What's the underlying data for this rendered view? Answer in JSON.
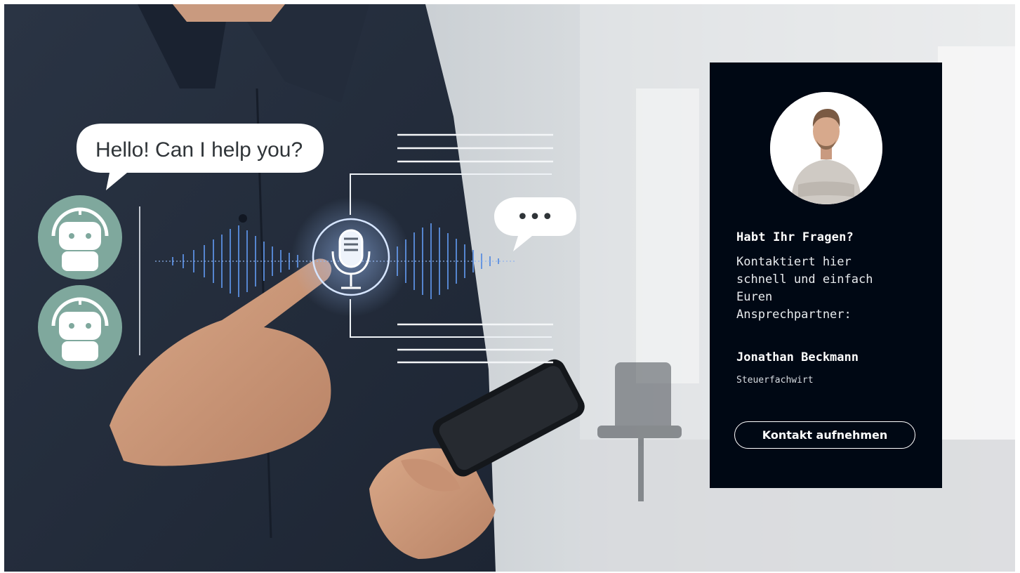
{
  "hero": {
    "chat_bubble_text": "Hello! Can I help you?",
    "typing_indicator": "•••"
  },
  "contact_card": {
    "title": "Habt Ihr Fragen?",
    "text": "Kontaktiert hier schnell und einfach Euren Ansprechpartner:",
    "name": "Jonathan Beckmann",
    "role": "Steuerfachwirt",
    "button_label": "Kontakt aufnehmen"
  },
  "colors": {
    "card_background": "#000814",
    "robot_badge": "#7fa89d",
    "voice_wave": "#5b8fe0"
  }
}
